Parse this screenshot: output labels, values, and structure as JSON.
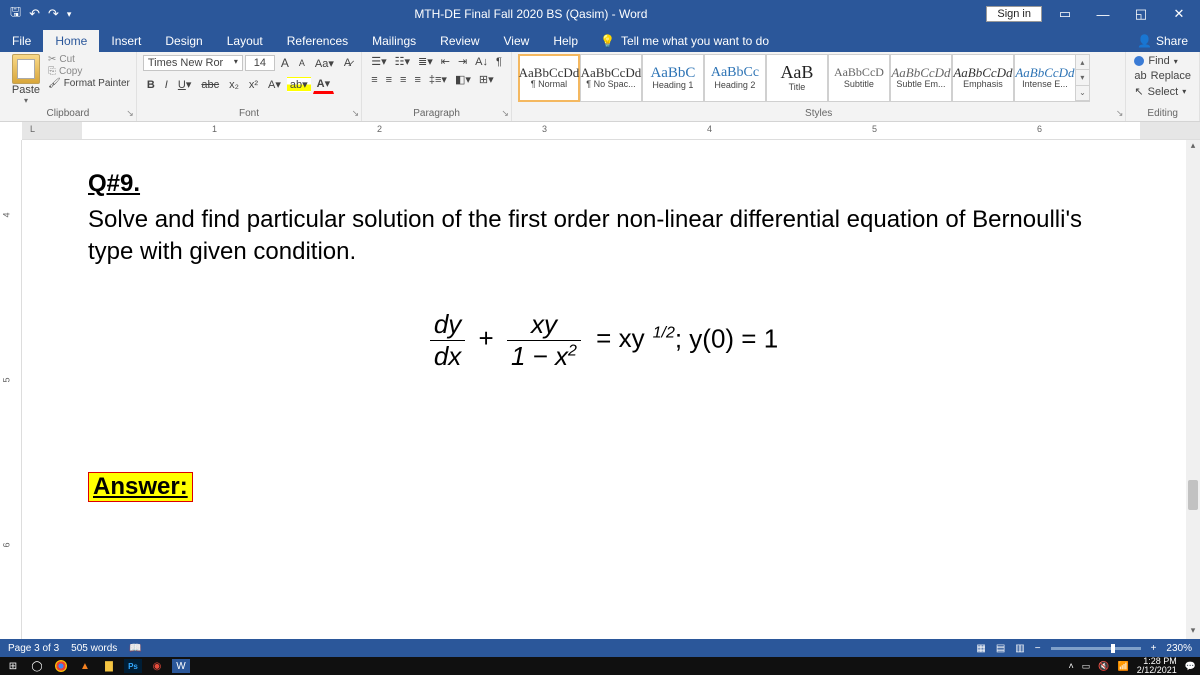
{
  "titlebar": {
    "title": "MTH-DE Final Fall 2020 BS (Qasim) - Word",
    "signin": "Sign in"
  },
  "tabs": {
    "file": "File",
    "home": "Home",
    "insert": "Insert",
    "design": "Design",
    "layout": "Layout",
    "references": "References",
    "mailings": "Mailings",
    "review": "Review",
    "view": "View",
    "help": "Help",
    "tellme": "Tell me what you want to do",
    "share": "Share"
  },
  "ribbon": {
    "clipboard": {
      "label": "Clipboard",
      "paste": "Paste",
      "cut": "Cut",
      "copy": "Copy",
      "fp": "Format Painter"
    },
    "font": {
      "label": "Font",
      "name": "Times New Ror",
      "size": "14"
    },
    "paragraph": {
      "label": "Paragraph"
    },
    "styles": {
      "label": "Styles",
      "items": [
        {
          "prev": "AaBbCcDd",
          "name": "¶ Normal"
        },
        {
          "prev": "AaBbCcDd",
          "name": "¶ No Spac..."
        },
        {
          "prev": "AaBbC",
          "name": "Heading 1"
        },
        {
          "prev": "AaBbCc",
          "name": "Heading 2"
        },
        {
          "prev": "AaB",
          "name": "Title"
        },
        {
          "prev": "AaBbCcD",
          "name": "Subtitle"
        },
        {
          "prev": "AaBbCcDd",
          "name": "Subtle Em..."
        },
        {
          "prev": "AaBbCcDd",
          "name": "Emphasis"
        },
        {
          "prev": "AaBbCcDd",
          "name": "Intense E..."
        }
      ]
    },
    "editing": {
      "label": "Editing",
      "find": "Find",
      "replace": "Replace",
      "select": "Select"
    }
  },
  "ruler": {
    "marks": [
      "1",
      "2",
      "3",
      "4",
      "5",
      "6"
    ],
    "vmarks": [
      "4",
      "5",
      "6"
    ]
  },
  "doc": {
    "qnum": "Q#9.",
    "qtext": "Solve and find particular solution of the first order non-linear differential equation of Bernoulli's type with given condition.",
    "eq": {
      "dy": "dy",
      "dx": "dx",
      "plus": "+",
      "xy": "xy",
      "den": "1 − x",
      "sq": "2",
      "eq": "= xy",
      "half": "1/2",
      "semi": ";  y(0) = 1"
    },
    "answer": "Answer:"
  },
  "statusbar": {
    "page": "Page 3 of 3",
    "words": "505 words",
    "zoom": "230%"
  },
  "taskbar": {
    "time": "1:28 PM",
    "date": "2/12/2021"
  }
}
